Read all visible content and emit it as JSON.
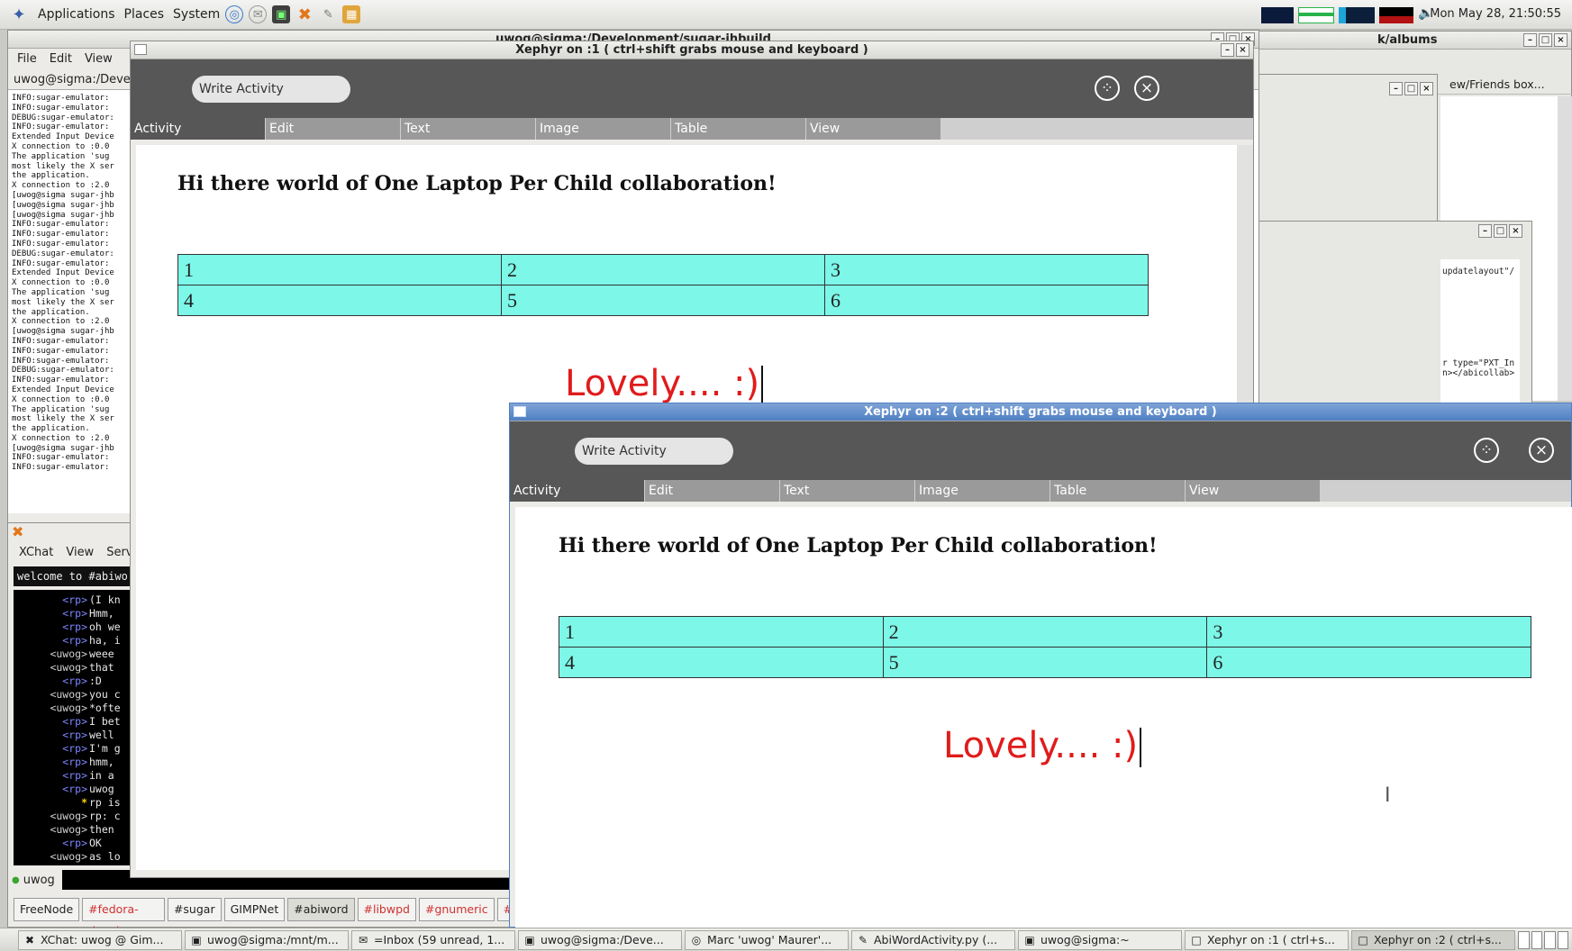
{
  "panel": {
    "menus": [
      "Applications",
      "Places",
      "System"
    ],
    "clock": "Mon May 28, 21:50:55"
  },
  "terminal": {
    "title": "uwog@sigma:/Development/sugar-jhbuild",
    "menus": [
      "File",
      "Edit",
      "View"
    ],
    "tab_label": "uwog@sigma:/Deve",
    "log": [
      "INFO:sugar-emulator:",
      "INFO:sugar-emulator:",
      "DEBUG:sugar-emulator:",
      "INFO:sugar-emulator:",
      "Extended Input Device",
      "X connection to :0.0",
      "The application 'sug",
      "most likely the X ser",
      "the application.",
      "X connection to :2.0",
      "[uwog@sigma sugar-jhb",
      "[uwog@sigma sugar-jhb",
      "[uwog@sigma sugar-jhb",
      "INFO:sugar-emulator:",
      "INFO:sugar-emulator:",
      "INFO:sugar-emulator:",
      "DEBUG:sugar-emulator:",
      "INFO:sugar-emulator:",
      "Extended Input Device",
      "X connection to :0.0",
      "The application 'sug",
      "most likely the X ser",
      "the application.",
      "X connection to :2.0",
      "[uwog@sigma sugar-jhb",
      "INFO:sugar-emulator:",
      "INFO:sugar-emulator:",
      "INFO:sugar-emulator:",
      "DEBUG:sugar-emulator:",
      "INFO:sugar-emulator:",
      "Extended Input Device",
      "X connection to :0.0",
      "The application 'sug",
      "most likely the X ser",
      "the application.",
      "X connection to :2.0",
      "[uwog@sigma sugar-jhb",
      "INFO:sugar-emulator:",
      "INFO:sugar-emulator:"
    ]
  },
  "xchat": {
    "menus": [
      "XChat",
      "View",
      "Serv"
    ],
    "topic": "welcome to #abiwo",
    "messages": [
      {
        "nick": "rp",
        "text": "(I kn"
      },
      {
        "nick": "rp",
        "text": "Hmm,"
      },
      {
        "nick": "rp",
        "text": "oh we"
      },
      {
        "nick": "rp",
        "text": "ha, i"
      },
      {
        "nick": "uwog",
        "text": "weee"
      },
      {
        "nick": "uwog",
        "text": "that"
      },
      {
        "nick": "rp",
        "text": ":D"
      },
      {
        "nick": "uwog",
        "text": "you c"
      },
      {
        "nick": "uwog",
        "text": "*ofte"
      },
      {
        "nick": "rp",
        "text": "I bet"
      },
      {
        "nick": "rp",
        "text": "well"
      },
      {
        "nick": "rp",
        "text": "I'm g"
      },
      {
        "nick": "rp",
        "text": "hmm,"
      },
      {
        "nick": "rp",
        "text": "in a"
      },
      {
        "nick": "rp",
        "text": "uwog"
      },
      {
        "nick": "*",
        "text": "rp is"
      },
      {
        "nick": "uwog",
        "text": "rp: c"
      },
      {
        "nick": "uwog",
        "text": "then"
      },
      {
        "nick": "rp",
        "text": "OK"
      },
      {
        "nick": "uwog",
        "text": "as lo"
      }
    ],
    "user": "uwog",
    "channels": [
      {
        "label": "FreeNode",
        "style": "plain"
      },
      {
        "label": "#fedora-devel",
        "style": "red"
      },
      {
        "label": "#sugar",
        "style": "plain"
      },
      {
        "label": "GIMPNet",
        "style": "plain"
      },
      {
        "label": "#abiword",
        "style": "sel"
      },
      {
        "label": "#libwpd",
        "style": "red"
      },
      {
        "label": "#gnumeric",
        "style": "red"
      },
      {
        "label": "#g",
        "style": "red"
      }
    ]
  },
  "right_windows": {
    "albums_title": "k/albums",
    "friends_tab": "ew/Friends box...",
    "code_lines": [
      "updatelayout\"/",
      "r type=\"PXT_In",
      "n></abicollab>"
    ]
  },
  "xephyr1": {
    "title": "Xephyr on :1 ( ctrl+shift grabs mouse and keyboard )",
    "activity_name": "Write Activity",
    "tabs": [
      "Activity",
      "Edit",
      "Text",
      "Image",
      "Table",
      "View"
    ],
    "heading": "Hi there world of One Laptop Per Child collaboration!",
    "table": [
      [
        "1",
        "2",
        "3"
      ],
      [
        "4",
        "5",
        "6"
      ]
    ],
    "lovely": "Lovely.... :)"
  },
  "xephyr2": {
    "title": "Xephyr on :2 ( ctrl+shift grabs mouse and keyboard )",
    "activity_name": "Write Activity",
    "tabs": [
      "Activity",
      "Edit",
      "Text",
      "Image",
      "Table",
      "View"
    ],
    "heading": "Hi there world of One Laptop Per Child collaboration!",
    "table": [
      [
        "1",
        "2",
        "3"
      ],
      [
        "4",
        "5",
        "6"
      ]
    ],
    "lovely": "Lovely.... :)"
  },
  "taskbar": {
    "tasks": [
      {
        "label": "XChat: uwog @ Gim...",
        "icon": "xchat-icon"
      },
      {
        "label": "uwog@sigma:/mnt/m...",
        "icon": "terminal-icon"
      },
      {
        "label": "=Inbox (59 unread, 1...",
        "icon": "mail-icon"
      },
      {
        "label": "uwog@sigma:/Deve...",
        "icon": "terminal-icon"
      },
      {
        "label": "Marc 'uwog' Maurer'...",
        "icon": "browser-icon"
      },
      {
        "label": "AbiWordActivity.py (...",
        "icon": "editor-icon"
      },
      {
        "label": "uwog@sigma:~",
        "icon": "terminal-icon"
      },
      {
        "label": "Xephyr on :1 ( ctrl+s...",
        "icon": "window-icon"
      },
      {
        "label": "Xephyr on :2 ( ctrl+s...",
        "icon": "window-icon"
      }
    ]
  }
}
